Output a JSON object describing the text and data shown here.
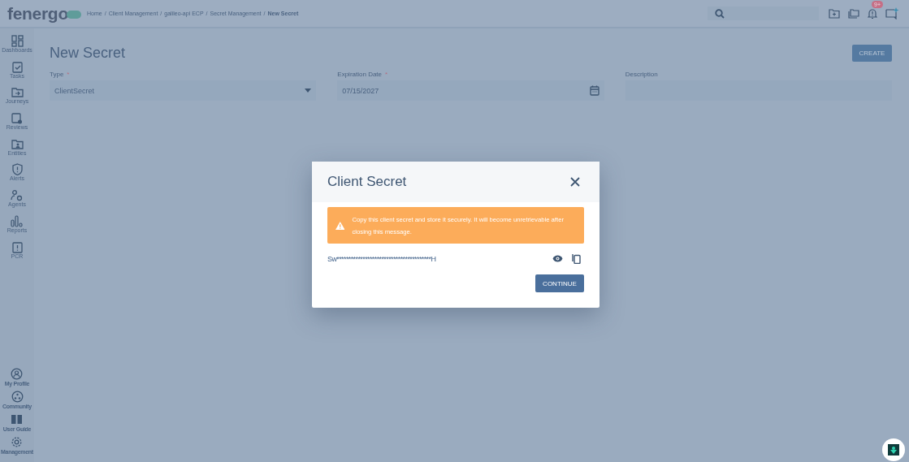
{
  "header": {
    "logo": "fenergo",
    "breadcrumb": [
      {
        "label": "Home",
        "current": false
      },
      {
        "label": "Client Management",
        "current": false
      },
      {
        "label": "galileo-api ECP",
        "current": false
      },
      {
        "label": "Secret Management",
        "current": false
      },
      {
        "label": "New Secret",
        "current": true
      }
    ],
    "breadcrumb_separator": "/",
    "notification_badge": "9+"
  },
  "sidebar": {
    "items": [
      {
        "label": "Dashboards"
      },
      {
        "label": "Tasks"
      },
      {
        "label": "Journeys"
      },
      {
        "label": "Reviews"
      },
      {
        "label": "Entities"
      },
      {
        "label": "Alerts"
      },
      {
        "label": "Agents"
      },
      {
        "label": "Reports"
      },
      {
        "label": "PCR"
      }
    ],
    "bottom_items": [
      {
        "label": "My Profile"
      },
      {
        "label": "Community"
      },
      {
        "label": "User Guide"
      },
      {
        "label": "Management"
      }
    ]
  },
  "page": {
    "title": "New Secret",
    "create_button": "CREATE",
    "fields": [
      {
        "kind": "select",
        "label": "Type",
        "required_mark": "*",
        "value": "ClientSecret"
      },
      {
        "kind": "date",
        "label": "Expiration Date",
        "required_mark": "*",
        "value": "07/15/2027"
      },
      {
        "kind": "text",
        "label": "Description"
      }
    ]
  },
  "dialog": {
    "title": "Client Secret",
    "warning": "Copy this client secret and store it securely. It will become unretrievable after closing this message.",
    "secret": "Sw****************************************H",
    "continue_button": "CONTINUE"
  }
}
